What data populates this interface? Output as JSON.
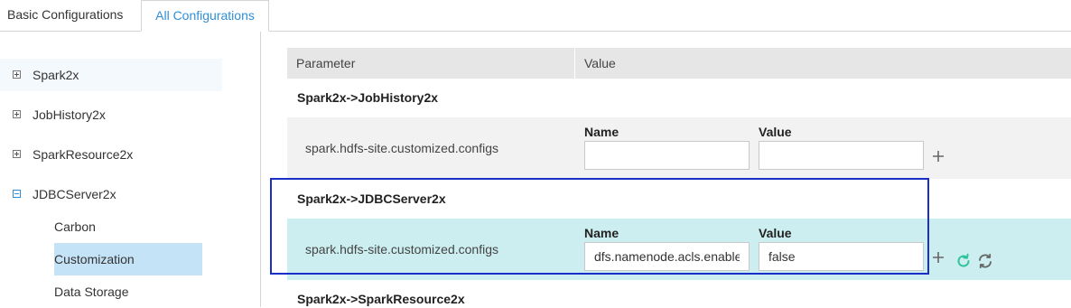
{
  "tabs": [
    {
      "label": "Basic Configurations",
      "active": false
    },
    {
      "label": "All Configurations",
      "active": true
    }
  ],
  "sidebar": {
    "nodes": [
      {
        "label": "Spark2x",
        "expanded": false
      },
      {
        "label": "JobHistory2x",
        "expanded": false
      },
      {
        "label": "SparkResource2x",
        "expanded": false
      },
      {
        "label": "JDBCServer2x",
        "expanded": true
      }
    ],
    "children": [
      {
        "label": "Carbon",
        "selected": false
      },
      {
        "label": "Customization",
        "selected": true
      },
      {
        "label": "Data Storage",
        "selected": false
      }
    ]
  },
  "table": {
    "headers": [
      "Parameter",
      "Value"
    ],
    "sections": [
      {
        "title": "Spark2x->JobHistory2x",
        "row": {
          "parameter": "spark.hdfs-site.customized.configs",
          "name_label": "Name",
          "value_label": "Value",
          "name_value": "",
          "value_value": ""
        }
      },
      {
        "title": "Spark2x->JDBCServer2x",
        "row": {
          "parameter": "spark.hdfs-site.customized.configs",
          "name_label": "Name",
          "value_label": "Value",
          "name_value": "dfs.namenode.acls.enable",
          "value_value": "false"
        }
      },
      {
        "title": "Spark2x->SparkResource2x"
      }
    ]
  },
  "colors": {
    "accent": "#2f8fd8",
    "selected_bg": "#c5e3f6",
    "modified_row_bg": "#cdeef0",
    "highlight_border": "#1a2fc8",
    "restore_icon": "#2fc39b"
  },
  "icons": [
    "expand-icon",
    "collapse-icon",
    "plus-icon",
    "restore-icon",
    "sync-icon"
  ]
}
